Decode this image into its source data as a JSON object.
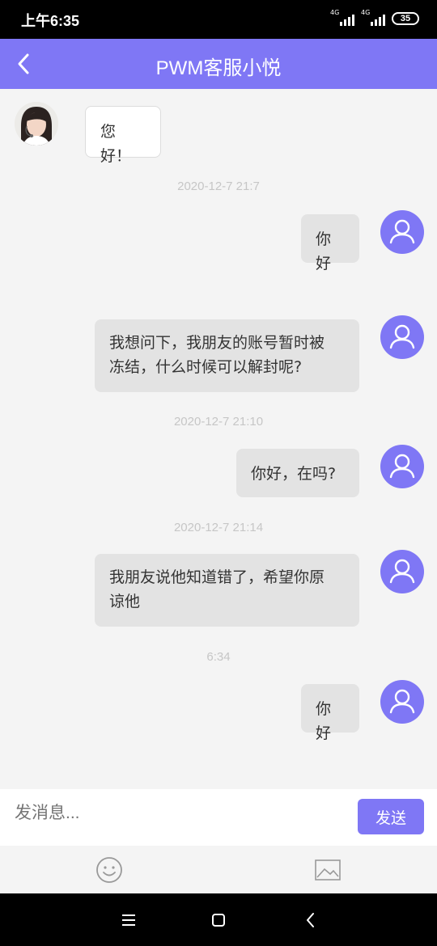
{
  "status_bar": {
    "time": "上午6:35",
    "network_1": "4G",
    "network_2": "4G",
    "battery": "35"
  },
  "header": {
    "title": "PWM客服小悦",
    "back_icon": "chevron-left-icon"
  },
  "messages": [
    {
      "sender": "agent",
      "text": "您好！"
    },
    {
      "timestamp": "2020-12-7 21:7"
    },
    {
      "sender": "user",
      "text": "你好"
    },
    {
      "sender": "user",
      "text": "我想问下，我朋友的账号暂时被冻结，什么时候可以解封呢?"
    },
    {
      "timestamp": "2020-12-7 21:10"
    },
    {
      "sender": "user",
      "text": "你好，在吗?"
    },
    {
      "timestamp": "2020-12-7 21:14"
    },
    {
      "sender": "user",
      "text": "我朋友说他知道错了，希望你原谅他"
    },
    {
      "timestamp": "6:34"
    },
    {
      "sender": "user",
      "text": "你好"
    }
  ],
  "m": {
    "agent_hello": "您好！",
    "ts1": "2020-12-7 21:7",
    "u1": "你好",
    "u2_line1": "我想问下，我朋友的账号暂时被",
    "u2_line2": "冻结，什么时候可以解封呢?",
    "ts2": "2020-12-7 21:10",
    "u3": "你好，在吗?",
    "ts3": "2020-12-7 21:14",
    "u4_line1": "我朋友说他知道错了，希望你原",
    "u4_line2": "谅他",
    "ts4": "6:34",
    "u5": "你好"
  },
  "composer": {
    "placeholder": "发消息...",
    "send_label": "发送"
  },
  "toolbar": {
    "icons": [
      "emoji-icon",
      "image-icon"
    ]
  },
  "nav_bar": {
    "icons": [
      "menu-icon",
      "home-square-icon",
      "back-icon"
    ]
  },
  "colors": {
    "accent": "#7f77f5",
    "user_bubble": "#e3e3e3",
    "agent_bubble": "#ffffff",
    "background": "#f4f4f4",
    "timestamp": "#c6c6c6"
  }
}
